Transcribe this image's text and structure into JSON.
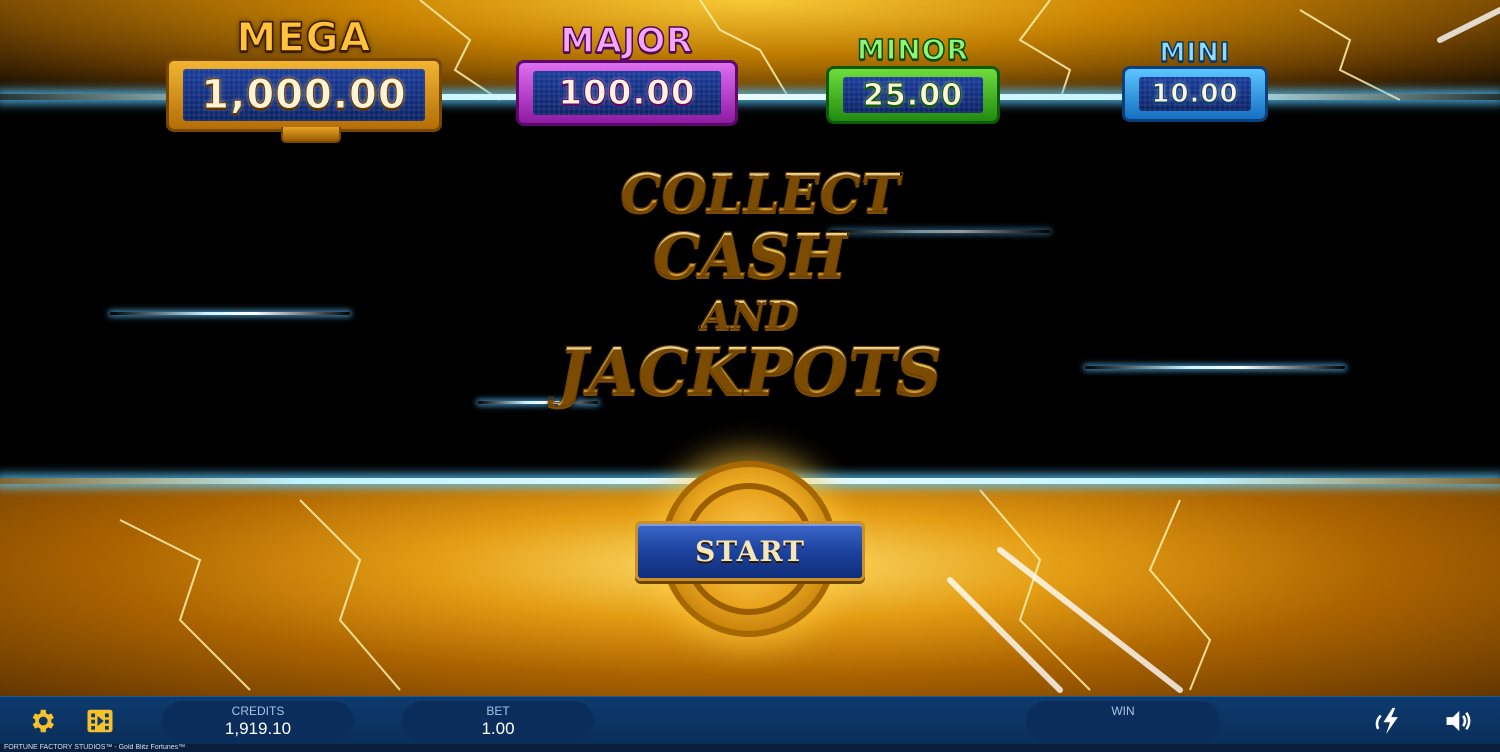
{
  "jackpots": {
    "mega": {
      "label": "MEGA",
      "value": "1,000.00"
    },
    "major": {
      "label": "MAJOR",
      "value": "100.00"
    },
    "minor": {
      "label": "MINOR",
      "value": "25.00"
    },
    "mini": {
      "label": "MINI",
      "value": "10.00"
    }
  },
  "headline": {
    "line1": "COLLECT",
    "line2": "CASH",
    "line3": "AND",
    "line4": "JACKPOTS"
  },
  "start_button": {
    "label": "START"
  },
  "bottom_bar": {
    "credits": {
      "label": "CREDITS",
      "value": "1,919.10"
    },
    "bet": {
      "label": "BET",
      "value": "1.00"
    },
    "win": {
      "label": "WIN",
      "value": ""
    },
    "icons": [
      "gear-icon",
      "film-icon",
      "turbo-lightning-icon",
      "speaker-icon"
    ]
  },
  "footer_text": "FORTUNE FACTORY STUDIOS™ - Gold Blitz Fortunes™",
  "colors": {
    "mega": "#ffc23a",
    "major": "#f4a6ff",
    "minor": "#8cf57a",
    "mini": "#8fdcff",
    "bar": "#0d3a6e",
    "start": "#1d43a0",
    "gold": "#ffd86a"
  }
}
